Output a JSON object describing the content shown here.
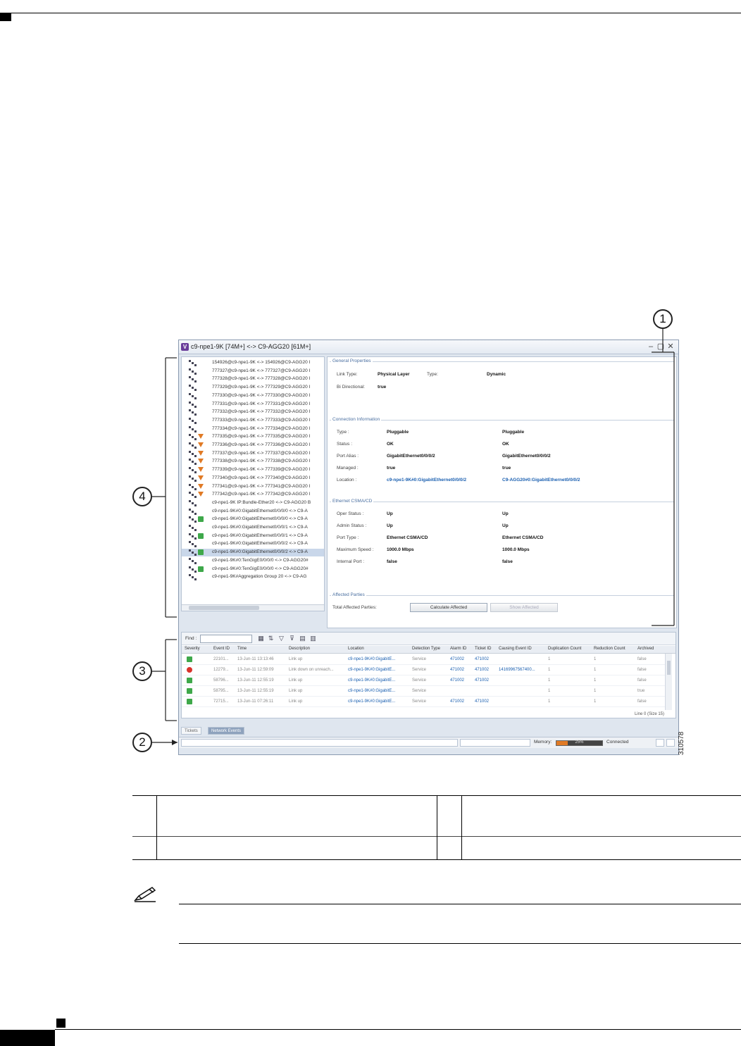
{
  "window": {
    "title": "c9-npe1-9K [74M+] <-> C9-AGG20 [61M+]",
    "app_icon": "V",
    "controls": [
      "–",
      "▢",
      "✕"
    ]
  },
  "tree": {
    "items": [
      {
        "label": "154926@c9-npe1-9K <-> 154926@C9-AGG20 I",
        "badge": "none"
      },
      {
        "label": "777327@c9-npe1-9K <-> 777327@C9-AGG20 I",
        "badge": "none"
      },
      {
        "label": "777328@c9-npe1-9K <-> 777328@C9-AGG20 I",
        "badge": "none"
      },
      {
        "label": "777329@c9-npe1-9K <-> 777329@C9-AGG20 I",
        "badge": "none"
      },
      {
        "label": "777330@c9-npe1-9K <-> 777330@C9-AGG20 I",
        "badge": "none"
      },
      {
        "label": "777331@c9-npe1-9K <-> 777331@C9-AGG20 I",
        "badge": "none"
      },
      {
        "label": "777332@c9-npe1-9K <-> 777332@C9-AGG20 I",
        "badge": "none"
      },
      {
        "label": "777333@c9-npe1-9K <-> 777333@C9-AGG20 I",
        "badge": "none"
      },
      {
        "label": "777334@c9-npe1-9K <-> 777334@C9-AGG20 I",
        "badge": "none"
      },
      {
        "label": "777335@c9-npe1-9K <-> 777335@C9-AGG20 I",
        "badge": "alarm"
      },
      {
        "label": "777336@c9-npe1-9K <-> 777336@C9-AGG20 I",
        "badge": "alarm"
      },
      {
        "label": "777337@c9-npe1-9K <-> 777337@C9-AGG20 I",
        "badge": "alarm"
      },
      {
        "label": "777338@c9-npe1-9K <-> 777338@C9-AGG20 I",
        "badge": "alarm"
      },
      {
        "label": "777339@c9-npe1-9K <-> 777339@C9-AGG20 I",
        "badge": "alarm"
      },
      {
        "label": "777340@c9-npe1-9K <-> 777340@C9-AGG20 I",
        "badge": "alarm"
      },
      {
        "label": "777341@c9-npe1-9K <-> 777341@C9-AGG20 I",
        "badge": "alarm"
      },
      {
        "label": "777342@c9-npe1-9K <-> 777342@C9-AGG20 I",
        "badge": "alarm"
      },
      {
        "label": "c9-npe1-9K IP:Bundle-Ether20 <-> C9-AGG20 B",
        "badge": "none"
      },
      {
        "label": "c9-npe1-9K#0:GigabitEthernet0/0/0/0 <-> C9-A",
        "badge": "none"
      },
      {
        "label": "c9-npe1-9K#0:GigabitEthernet0/0/0/0 <-> C9-A",
        "badge": "ok"
      },
      {
        "label": "c9-npe1-9K#0:GigabitEthernet0/0/0/1 <-> C9-A",
        "badge": "none"
      },
      {
        "label": "c9-npe1-9K#0:GigabitEthernet0/0/0/1 <-> C9-A",
        "badge": "ok"
      },
      {
        "label": "c9-npe1-9K#0:GigabitEthernet0/0/0/2 <-> C9-A",
        "badge": "none"
      },
      {
        "label": "c9-npe1-9K#0:GigabitEthernet0/0/0/2 <-> C9-A",
        "badge": "ok"
      },
      {
        "label": "c9-npe1-9K#0:TenGigE0/0/0/0 <-> C9-AGG20#",
        "badge": "none"
      },
      {
        "label": "c9-npe1-9K#0:TenGigE0/0/0/0 <-> C9-AGG20#",
        "badge": "ok"
      },
      {
        "label": "c9-npe1-9K#Aggregation Group 20 <-> C9-AG",
        "badge": "none"
      }
    ],
    "selected_index": 23
  },
  "props": {
    "general": {
      "title": "General Properties",
      "link_type_label": "Link Type:",
      "link_type": "Physical Layer",
      "type_label": "Type:",
      "type": "Dynamic",
      "bidir_label": "Bi Directional:",
      "bidir": "true"
    },
    "connection": {
      "title": "Connection Information",
      "rows": [
        {
          "label": "Type :",
          "a": "Pluggable",
          "b": "Pluggable"
        },
        {
          "label": "Status :",
          "a": "OK",
          "b": "OK"
        },
        {
          "label": "Port Alias :",
          "a": "GigabitEthernet0/0/0/2",
          "b": "GigabitEthernet0/0/0/2"
        },
        {
          "label": "Managed :",
          "a": "true",
          "b": "true"
        },
        {
          "label": "Location :",
          "a": "c9-npe1-9K#0:GigabitEthernet0/0/0/2",
          "b": "C9-AGG20#0:GigabitEthernet0/0/0/2"
        }
      ]
    },
    "ethernet": {
      "title": "Ethernet CSMA/CD",
      "rows": [
        {
          "label": "Oper Status :",
          "a": "Up",
          "b": "Up"
        },
        {
          "label": "Admin Status :",
          "a": "Up",
          "b": "Up"
        },
        {
          "label": "Port Type :",
          "a": "Ethernet CSMA/CD",
          "b": "Ethernet CSMA/CD"
        },
        {
          "label": "Maximum Speed :",
          "a": "1000.0 Mbps",
          "b": "1000.0 Mbps"
        },
        {
          "label": "Internal Port :",
          "a": "false",
          "b": "false"
        }
      ]
    },
    "affected": {
      "title": "Affected Parties",
      "total_label": "Total Affected Parties:",
      "calc_button": "Calculate Affected",
      "show_button": "Show Affected"
    }
  },
  "events": {
    "find_label": "Find :",
    "columns": [
      "Severity",
      "Event ID",
      "Time",
      "Description",
      "Location",
      "Detection Type",
      "Alarm ID",
      "Ticket ID",
      "Causing Event ID",
      "Duplication Count",
      "Reduction Count",
      "Archived"
    ],
    "rows": [
      {
        "severity": "ok",
        "event_id": "22101...",
        "time": "13-Jun-11 13:13:46",
        "description": "Link up",
        "location": "c9-npe1-9K#0:GigabitE...",
        "detection": "Service",
        "alarm": "471002",
        "ticket": "471002",
        "causing": "",
        "dup": "1",
        "red": "1",
        "archived": "false"
      },
      {
        "severity": "critical",
        "event_id": "12279...",
        "time": "13-Jun-11 12:59:09",
        "description": "Link down on unreach...",
        "location": "c9-npe1-9K#0:GigabitE...",
        "detection": "Service",
        "alarm": "471002",
        "ticket": "471002",
        "causing": "14169967567400...",
        "dup": "1",
        "red": "1",
        "archived": "false"
      },
      {
        "severity": "ok",
        "event_id": "58796...",
        "time": "13-Jun-11 12:55:19",
        "description": "Link up",
        "location": "c9-npe1-9K#0:GigabitE...",
        "detection": "Service",
        "alarm": "471002",
        "ticket": "471002",
        "causing": "",
        "dup": "1",
        "red": "1",
        "archived": "false"
      },
      {
        "severity": "ok",
        "event_id": "58795...",
        "time": "13-Jun-11 12:55:19",
        "description": "Link up",
        "location": "c9-npe1-9K#0:GigabitE...",
        "detection": "Service",
        "alarm": "",
        "ticket": "",
        "causing": "",
        "dup": "1",
        "red": "1",
        "archived": "true"
      },
      {
        "severity": "ok",
        "event_id": "72715...",
        "time": "13-Jun-11 07:26:11",
        "description": "Link up",
        "location": "c9-npe1-9K#0:GigabitE...",
        "detection": "Service",
        "alarm": "471002",
        "ticket": "471002",
        "causing": "",
        "dup": "1",
        "red": "1",
        "archived": "false"
      }
    ],
    "line_count": "Line 0 (Size 15)"
  },
  "tabs": [
    "Tickets",
    "Network Events"
  ],
  "statusbar": {
    "memory_label": "Memory:",
    "memory_pct": "25%",
    "memory_fraction": 0.25,
    "connection": "Connected"
  },
  "callouts": [
    "1",
    "2",
    "3",
    "4"
  ],
  "figure_number": "310578",
  "colors": {
    "alarm": "#e07a25",
    "ok": "#3ea84a",
    "critical": "#d9332b",
    "link": "#1a5fb0"
  }
}
